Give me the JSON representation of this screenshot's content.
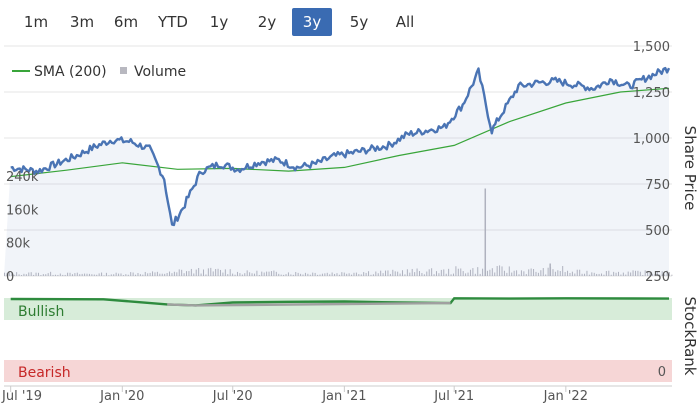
{
  "ranges": [
    "1m",
    "3m",
    "6m",
    "YTD",
    "1y",
    "2y",
    "3y",
    "5y",
    "All"
  ],
  "active_range": "3y",
  "colors": {
    "price": "#4a74b4",
    "sma": "#39a53a",
    "volume": "#b8b8c0",
    "stockrank_bull": "#2e8b3e",
    "stockrank_neutral": "#a0a0a0",
    "bull_band": "#d7ecd9",
    "bear_band": "#f6d6d6"
  },
  "chart_data": {
    "type": "line",
    "legend": [
      "SMA (200)",
      "Volume"
    ],
    "legend_position": "top-left",
    "x_ticks": [
      "Jul '19",
      "Jan '20",
      "Jul '20",
      "Jan '21",
      "Jul '21",
      "Jan '22"
    ],
    "price_axis": {
      "label": "Share Price",
      "ticks": [
        "1,500",
        "1,250",
        "1,000",
        "750",
        "500",
        "250"
      ],
      "range": [
        250,
        1500
      ]
    },
    "volume_axis": {
      "ticks": [
        "240k",
        "160k",
        "80k",
        "0"
      ],
      "range": [
        0,
        240000
      ]
    },
    "stockrank_axis": {
      "label": "StockRank",
      "tick": "0"
    },
    "stockrank_bands": {
      "upper": "Bullish",
      "lower": "Bearish"
    },
    "series": [
      {
        "name": "Price",
        "x": [
          "2019-07-01",
          "2019-08-15",
          "2019-09-15",
          "2019-10-15",
          "2019-11-15",
          "2019-12-15",
          "2020-01-15",
          "2020-02-15",
          "2020-03-10",
          "2020-03-23",
          "2020-04-10",
          "2020-05-10",
          "2020-06-10",
          "2020-07-10",
          "2020-08-15",
          "2020-09-15",
          "2020-10-15",
          "2020-11-15",
          "2020-12-15",
          "2021-01-15",
          "2021-02-15",
          "2021-03-15",
          "2021-04-15",
          "2021-05-15",
          "2021-06-15",
          "2021-07-15",
          "2021-08-10",
          "2021-09-01",
          "2021-09-15",
          "2021-10-15",
          "2021-11-15",
          "2021-12-15",
          "2022-01-15",
          "2022-02-15",
          "2022-03-01",
          "2022-03-15",
          "2022-04-15",
          "2022-05-15",
          "2022-06-20"
        ],
        "values": [
          840,
          820,
          860,
          900,
          950,
          990,
          980,
          940,
          780,
          520,
          620,
          820,
          860,
          830,
          870,
          880,
          840,
          860,
          900,
          920,
          940,
          960,
          1020,
          1040,
          1060,
          1180,
          1360,
          1040,
          1120,
          1280,
          1300,
          1310,
          1290,
          1270,
          1290,
          1320,
          1280,
          1330,
          1380
        ]
      },
      {
        "name": "SMA (200)",
        "x": [
          "2019-07-01",
          "2019-10-01",
          "2020-01-01",
          "2020-04-01",
          "2020-07-01",
          "2020-10-01",
          "2021-01-01",
          "2021-04-01",
          "2021-07-01",
          "2021-10-01",
          "2022-01-01",
          "2022-04-01",
          "2022-06-20"
        ],
        "values": [
          790,
          825,
          865,
          830,
          835,
          820,
          840,
          905,
          960,
          1090,
          1190,
          1250,
          1270
        ]
      },
      {
        "name": "Volume",
        "x": [
          "2019-07-01",
          "2019-10-01",
          "2020-01-01",
          "2020-04-01",
          "2020-07-01",
          "2020-10-01",
          "2021-01-01",
          "2021-04-01",
          "2021-07-01",
          "2021-08-20",
          "2021-10-01",
          "2021-12-05",
          "2022-01-01",
          "2022-04-01",
          "2022-06-20"
        ],
        "values": [
          6000,
          5000,
          7000,
          12000,
          8000,
          7000,
          9000,
          11000,
          14000,
          210000,
          12000,
          30000,
          9000,
          8000,
          7000
        ]
      },
      {
        "name": "StockRank",
        "x": [
          "2019-07-01",
          "2019-12-01",
          "2020-03-15",
          "2020-05-01",
          "2020-07-01",
          "2020-10-01",
          "2021-01-01",
          "2021-04-01",
          "2021-06-25",
          "2021-07-01",
          "2021-10-01",
          "2022-01-01",
          "2022-06-20"
        ],
        "values": [
          97,
          96,
          80,
          77,
          86,
          88,
          89,
          86,
          84,
          99,
          98,
          99,
          98
        ]
      }
    ]
  }
}
